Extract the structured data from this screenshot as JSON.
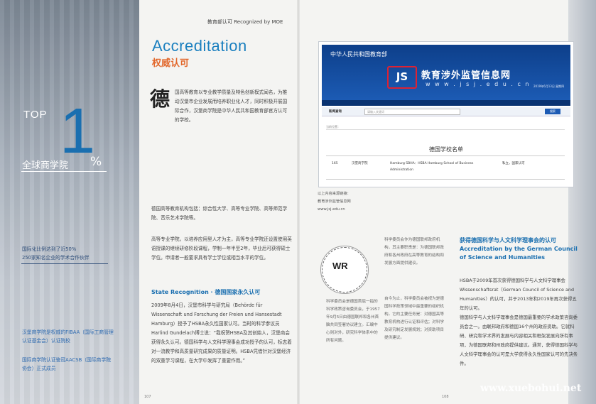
{
  "header": {
    "label": "教育部认可 Recognized by MOE"
  },
  "accreditation": {
    "title_en": "Accreditation",
    "title_cn": "权威认可"
  },
  "intro": {
    "dropcap": "德",
    "text": "国高等教育以专业教学质量及特色创新模式闻名，为推动汉堡市企业发展而培养职业化人才，同时积极开展国际合作，汉堡商学院是中华人民共和国教育部官方认可的学校。"
  },
  "left_panel": {
    "top_word": "TOP",
    "big_number": "1",
    "percent": "%",
    "global_label": "全球商学院",
    "stat_line1": "国际化比例达到了近50%",
    "stat_line2": "250家知名企业的学术合作伙伴",
    "accr1": "汉堡商学院是权威的FIBAA（国际工商管理认证基金会）认证院校",
    "accr2": "国际商学院认证鉴冠AACSB（国际商学院协会）正式成员"
  },
  "body": {
    "para1": "德国高等教育机构包括：综合性大学、高等专业学院、高等师范学院、音乐艺术学院等。",
    "para2": "高等专业学院，以培养应用型人才为主，高等专业学院还设置使用英语授课的继续研修阶段课程，学制一年半至2年，毕业后可获得硕士学位。申请者一般要求具有学士学位或相当水平的学位。",
    "section_title": "State Recognition · 德国国家永久认可",
    "para3": "2009年8月4日，汉堡市科学与研究局（Behörde für Wissenschaft und Forschung der Freien und Hansestadt Hamburg）授予了HSBA永久性国家认可。当时的科学参议员Harlind Gundelach博士说：“我祝贺HSBA及其创始人，汉堡商会获得永久认可。德国科学与人文科学理事会成功授予的认可，标志着对一流教学和高质量研究成果的质量证明。HSBA凭借针对汉堡经济的双重学习课程，在大学中发挥了重要作用。”"
  },
  "screenshot": {
    "top_title": "中华人民共和国教育部",
    "site_name": "教育涉外监管信息网",
    "site_url": "w w w . j s j . e d u . c n",
    "date": "2019年6月13日 星期四",
    "nav": [
      "首页",
      "监管信息",
      "留学预警",
      "中外合作办学",
      "认证学历",
      "留学中介",
      "自费出国",
      "外籍人员",
      "教育国际",
      "专家观点"
    ],
    "search_label": "新闻查询",
    "search_placeholder": "请输入关键词",
    "search_button": "搜索",
    "bar_text": "当前位置：",
    "list_title": "德国学校名单",
    "row_no": "165",
    "row_city": "汉堡商学院",
    "row_name": "Hamburg SBHA：HSBA Hamburg School of Business Administration",
    "row_type": "私立，国家认可"
  },
  "source": {
    "line1": "以上内容来源链接：",
    "line2": "教育涉外监管信息网",
    "line3": "www.jsj.edu.cn"
  },
  "wr_logo": {
    "letters": "WR",
    "ring_text": "WISSENSCHAFTSRAT"
  },
  "mid_col": {
    "top": "科学委员会作为德国联邦政府机构，其主要职责是：为德国联邦政府和各州政府在高等教育的结构和发展方面提供建议。",
    "left": "科学委员会是德国首屈一指的科学政策咨询委员会，于1957年9月5日由德国联邦和各州首脑共同签署协议建立。汇编中心则对外，研究科学体系中的所有问题。",
    "right": "自今为止，科学委员会被视为是德国科学政策领域中最重要的组织机构。它的主要任务是：对德国高等教育机构进行认证和评估；对科学及研究制定发展规划；对资助项目提供建议。"
  },
  "right": {
    "title_cn": "获得德国科学与人文科学理事会的认可",
    "title_en": "Accreditation by the German Council of Science and Humanities",
    "para1": "HSBA于2009年首次获得德国科学与人文科学理事会Wissenschaftsrat（German Council of Science and Humanities）的认可，并于2013年和2019年再次获得五年的认可。",
    "para2": "德国科学与人文科学理事会是德国最重要的学术政策咨询委员会之一。由联邦政府和德国16个州的政府资助。它就科研、研究和学术界的发展与内容相关和框架发展向所有事项，为德国联邦和州政府提供建议。通常，获得德国科学与人文科学理事会的认可是大学获得永久性国家认可的先决条件。"
  },
  "page_numbers": {
    "left": "107",
    "right": "108"
  },
  "watermark": "www.xuebohui.net"
}
